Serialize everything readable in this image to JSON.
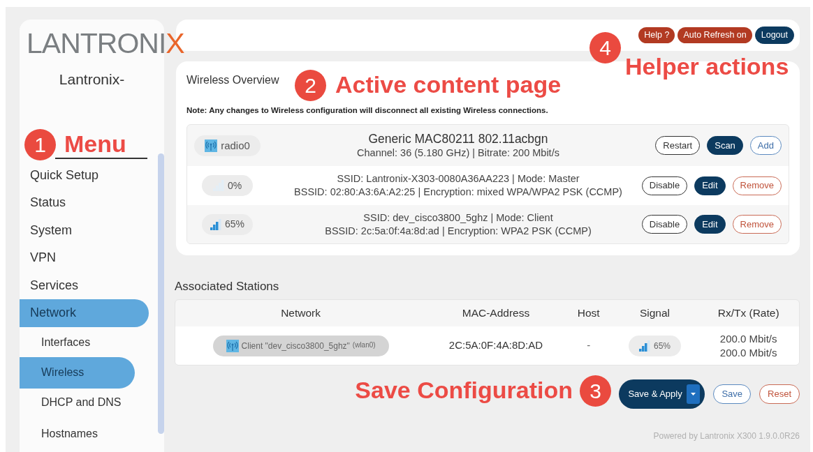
{
  "sidebar": {
    "logo": {
      "text": "LANTRONI",
      "accent": "X"
    },
    "hostname": "Lantronix-",
    "items": [
      {
        "label": "Quick Setup",
        "selected": false
      },
      {
        "label": "Status",
        "selected": false
      },
      {
        "label": "System",
        "selected": false
      },
      {
        "label": "VPN",
        "selected": false
      },
      {
        "label": "Services",
        "selected": false
      },
      {
        "label": "Network",
        "selected": true,
        "children": [
          {
            "label": "Interfaces",
            "selected": false
          },
          {
            "label": "Wireless",
            "selected": true
          },
          {
            "label": "DHCP and DNS",
            "selected": false
          },
          {
            "label": "Hostnames",
            "selected": false
          }
        ]
      }
    ]
  },
  "header": {
    "buttons": [
      {
        "label": "Help ?",
        "kind": "alert"
      },
      {
        "label": "Auto Refresh on",
        "kind": "alert"
      },
      {
        "label": "Logout",
        "kind": "primary"
      }
    ]
  },
  "wireless_overview": {
    "title": "Wireless Overview",
    "note": "Note: Any changes to Wireless configuration will disconnect all existing Wireless connections.",
    "radio": {
      "name": "radio0",
      "title": "Generic MAC80211 802.11acbgn",
      "details": "Channel: 36 (5.180 GHz) | Bitrate: 200 Mbit/s",
      "buttons": [
        {
          "label": "Restart",
          "kind": "outline"
        },
        {
          "label": "Scan",
          "kind": "primary"
        },
        {
          "label": "Add",
          "kind": "outline-blue"
        }
      ]
    },
    "networks": [
      {
        "signal": "0%",
        "kind": "no-signal",
        "lines": [
          "SSID: Lantronix-X303-0080A36AA223 | Mode: Master",
          "BSSID: 02:80:A3:6A:A2:25 | Encryption: mixed WPA/WPA2 PSK (CCMP)"
        ],
        "buttons": [
          {
            "label": "Disable",
            "kind": "outline"
          },
          {
            "label": "Edit",
            "kind": "primary"
          },
          {
            "label": "Remove",
            "kind": "outline-red"
          }
        ]
      },
      {
        "signal": "65%",
        "kind": "signal",
        "lines": [
          "SSID: dev_cisco3800_5ghz | Mode: Client",
          "BSSID: 2c:5a:0f:4a:8d:ad | Encryption: WPA2 PSK (CCMP)"
        ],
        "buttons": [
          {
            "label": "Disable",
            "kind": "outline"
          },
          {
            "label": "Edit",
            "kind": "primary"
          },
          {
            "label": "Remove",
            "kind": "outline-red"
          }
        ]
      }
    ]
  },
  "associated_stations": {
    "title": "Associated Stations",
    "columns": [
      "Network",
      "MAC-Address",
      "Host",
      "Signal",
      "Rx/Tx (Rate)"
    ],
    "rows": [
      {
        "network": "Client \"dev_cisco3800_5ghz\"",
        "interface": "(wlan0)",
        "mac": "2C:5A:0F:4A:8D:AD",
        "host": "-",
        "signal": "65%",
        "kind": "signal",
        "rate": [
          "200.0 Mbit/s",
          "200.0 Mbit/s"
        ]
      }
    ]
  },
  "actions": {
    "buttons": [
      {
        "label": "Save & Apply",
        "kind": "primary-split"
      },
      {
        "label": "Save",
        "kind": "outline-blue"
      },
      {
        "label": "Reset",
        "kind": "outline-red"
      }
    ]
  },
  "footer": "Powered by Lantronix X300 1.9.0.0R26",
  "annotations": [
    {
      "number": "1",
      "label": "Menu"
    },
    {
      "number": "2",
      "label": "Active content page"
    },
    {
      "number": "3",
      "label": "Save Configuration"
    },
    {
      "number": "4",
      "label": "Helper actions"
    }
  ]
}
